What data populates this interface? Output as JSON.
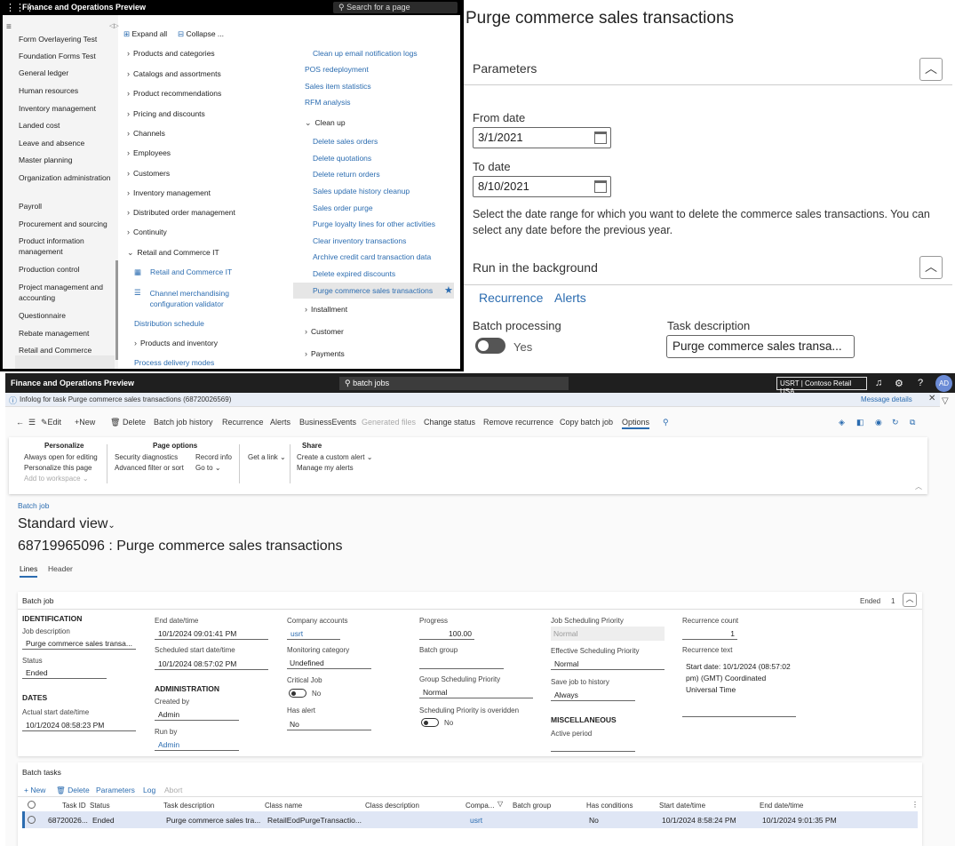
{
  "nav_panel": {
    "title": "Finance and Operations Preview",
    "search_placeholder": "Search for a page",
    "modules": [
      "Form Overlayering Test",
      "Foundation Forms Test",
      "General ledger",
      "Human resources",
      "Inventory management",
      "Landed cost",
      "Leave and absence",
      "Master planning",
      "Organization administration",
      "Payroll",
      "Procurement and sourcing",
      "Product information management",
      "Production control",
      "Project management and accounting",
      "Questionnaire",
      "Rebate management",
      "Retail and Commerce"
    ],
    "expand_all": "Expand all",
    "collapse": "Collapse ...",
    "groups": [
      "Products and categories",
      "Catalogs and assortments",
      "Product recommendations",
      "Pricing and discounts",
      "Channels",
      "Employees",
      "Customers",
      "Inventory management",
      "Distributed order management",
      "Continuity",
      "Retail and Commerce IT"
    ],
    "it_links": [
      "Retail and Commerce IT",
      "Channel merchandising configuration validator"
    ],
    "distribution_schedule": "Distribution schedule",
    "products_and_inventory": "Products and inventory",
    "process_delivery_modes": "Process delivery modes",
    "col2_links_top": [
      "Clean up email notification logs",
      "POS redeployment",
      "Sales item statistics",
      "RFM analysis"
    ],
    "clean_up": "Clean up",
    "clean_up_links": [
      "Delete sales orders",
      "Delete quotations",
      "Delete return orders",
      "Sales update history cleanup",
      "Sales order purge",
      "Purge loyalty lines for other activities",
      "Clear inventory transactions",
      "Archive credit card transaction data",
      "Delete expired discounts",
      "Purge commerce sales transactions"
    ],
    "col2_groups": [
      "Installment",
      "Customer",
      "Payments"
    ]
  },
  "dialog": {
    "title": "Purge commerce sales transactions",
    "parameters": "Parameters",
    "from_date_label": "From date",
    "from_date": "3/1/2021",
    "to_date_label": "To date",
    "to_date": "8/10/2021",
    "description": "Select the date range for which you want to delete the commerce sales transactions. You can select any date before the previous year.",
    "run_in_background": "Run in the background",
    "tab_recurrence": "Recurrence",
    "tab_alerts": "Alerts",
    "batch_processing_label": "Batch processing",
    "batch_processing_value": "Yes",
    "task_description_label": "Task description",
    "task_description": "Purge commerce sales transa..."
  },
  "batch_window": {
    "title": "Finance and Operations Preview",
    "search": "batch jobs",
    "company": "USRT | Contoso Retail USA",
    "avatar": "AD",
    "infolog": "Infolog for task Purge commerce sales transactions (68720026569)",
    "message_details": "Message details",
    "actions": [
      "Edit",
      "New",
      "Delete",
      "Batch job history",
      "Recurrence",
      "Alerts",
      "BusinessEvents",
      "Generated files",
      "Change status",
      "Remove recurrence",
      "Copy batch job",
      "Options"
    ],
    "options": {
      "personalize_header": "Personalize",
      "personalize_items": [
        "Always open for editing",
        "Personalize this page",
        "Add to workspace"
      ],
      "page_options_header": "Page options",
      "page_options_items": [
        "Security diagnostics",
        "Advanced filter or sort",
        "Record info",
        "Go to"
      ],
      "get_link": "Get a link",
      "share_header": "Share",
      "share_items": [
        "Create a custom alert",
        "Manage my alerts"
      ]
    },
    "breadcrumb": "Batch job",
    "view_name": "Standard view",
    "page_title": "68719965096 : Purge commerce sales transactions",
    "tabs": [
      "Lines",
      "Header"
    ],
    "batch_job_section": "Batch job",
    "status_badge": "Ended",
    "count_badge": "1",
    "fields": {
      "identification": "IDENTIFICATION",
      "job_description_label": "Job description",
      "job_description": "Purge commerce sales transa...",
      "status_label": "Status",
      "status": "Ended",
      "dates": "DATES",
      "actual_start_label": "Actual start date/time",
      "actual_start": "10/1/2024 08:58:23 PM",
      "end_label": "End date/time",
      "end": "10/1/2024 09:01:41 PM",
      "scheduled_start_label": "Scheduled start date/time",
      "scheduled_start": "10/1/2024 08:57:02 PM",
      "administration": "ADMINISTRATION",
      "created_by_label": "Created by",
      "created_by": "Admin",
      "run_by_label": "Run by",
      "run_by": "Admin",
      "company_accounts_label": "Company accounts",
      "company_accounts": "usrt",
      "monitoring_label": "Monitoring category",
      "monitoring": "Undefined",
      "critical_job_label": "Critical Job",
      "critical_job": "No",
      "has_alert_label": "Has alert",
      "has_alert": "No",
      "progress_label": "Progress",
      "progress": "100.00",
      "batch_group_label": "Batch group",
      "group_sched_label": "Group Scheduling Priority",
      "group_sched": "Normal",
      "sched_overridden_label": "Scheduling Priority is overidden",
      "sched_overridden": "No",
      "job_sched_label": "Job Scheduling Priority",
      "job_sched": "Normal",
      "eff_sched_label": "Effective Scheduling Priority",
      "eff_sched": "Normal",
      "save_history_label": "Save job to history",
      "save_history": "Always",
      "misc": "MISCELLANEOUS",
      "active_period_label": "Active period",
      "recurrence_count_label": "Recurrence count",
      "recurrence_count": "1",
      "recurrence_text_label": "Recurrence text",
      "recurrence_text": [
        "Start date: 10/1/2024 (08:57:02",
        "pm) (GMT) Coordinated",
        "Universal Time"
      ]
    },
    "batch_tasks": {
      "title": "Batch tasks",
      "actions": [
        "New",
        "Delete",
        "Parameters",
        "Log",
        "Abort"
      ],
      "headers": [
        "Task ID",
        "Status",
        "Task description",
        "Class name",
        "Class description",
        "Compa...",
        "Batch group",
        "Has conditions",
        "Start date/time",
        "End date/time"
      ],
      "row": [
        "68720026...",
        "Ended",
        "Purge commerce sales tra...",
        "RetailEodPurgeTransactio...",
        "",
        "usrt",
        "",
        "No",
        "10/1/2024 8:58:24 PM",
        "10/1/2024 9:01:35 PM"
      ]
    }
  }
}
